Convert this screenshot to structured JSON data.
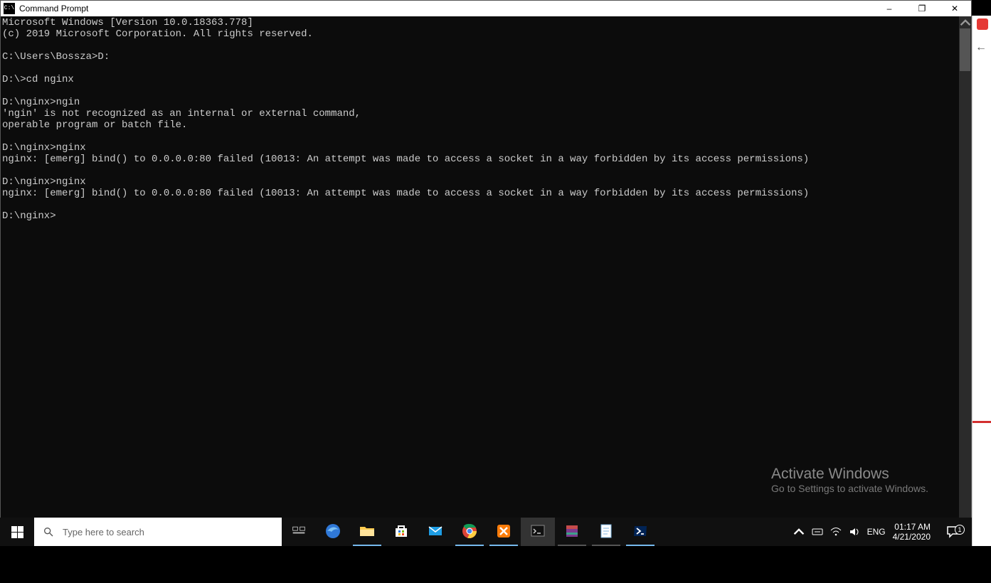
{
  "window": {
    "title": "Command Prompt",
    "icon_caption": "C:\\",
    "controls": {
      "minimize": "–",
      "maximize": "❐",
      "close": "✕"
    }
  },
  "terminal": {
    "lines": [
      "Microsoft Windows [Version 10.0.18363.778]",
      "(c) 2019 Microsoft Corporation. All rights reserved.",
      "",
      "C:\\Users\\Bossza>D:",
      "",
      "D:\\>cd nginx",
      "",
      "D:\\nginx>ngin",
      "'ngin' is not recognized as an internal or external command,",
      "operable program or batch file.",
      "",
      "D:\\nginx>nginx",
      "nginx: [emerg] bind() to 0.0.0.0:80 failed (10013: An attempt was made to access a socket in a way forbidden by its access permissions)",
      "",
      "D:\\nginx>nginx",
      "nginx: [emerg] bind() to 0.0.0.0:80 failed (10013: An attempt was made to access a socket in a way forbidden by its access permissions)",
      "",
      "D:\\nginx>"
    ]
  },
  "watermark": {
    "title": "Activate Windows",
    "subtitle": "Go to Settings to activate Windows."
  },
  "taskbar": {
    "search_placeholder": "Type here to search",
    "language": "ENG",
    "time": "01:17 AM",
    "date": "4/21/2020",
    "notifications": "1",
    "items": [
      {
        "name": "task-view",
        "state": "",
        "color": "#cccccc"
      },
      {
        "name": "edge",
        "state": "",
        "color": "#2f78d7"
      },
      {
        "name": "file-explorer",
        "state": "active",
        "color": "#ffcb4f"
      },
      {
        "name": "microsoft-store",
        "state": "",
        "color": "#ffffff"
      },
      {
        "name": "mail",
        "state": "",
        "color": "#1e9de4"
      },
      {
        "name": "chrome",
        "state": "active",
        "color": "#ffffff"
      },
      {
        "name": "xampp",
        "state": "active",
        "color": "#fb7c0a"
      },
      {
        "name": "command-prompt",
        "state": "current",
        "color": "#111111"
      },
      {
        "name": "winrar",
        "state": "running",
        "color": "#7c3b8f"
      },
      {
        "name": "notepad",
        "state": "running",
        "color": "#7fb6e0"
      },
      {
        "name": "powershell",
        "state": "active",
        "color": "#012456"
      }
    ]
  }
}
